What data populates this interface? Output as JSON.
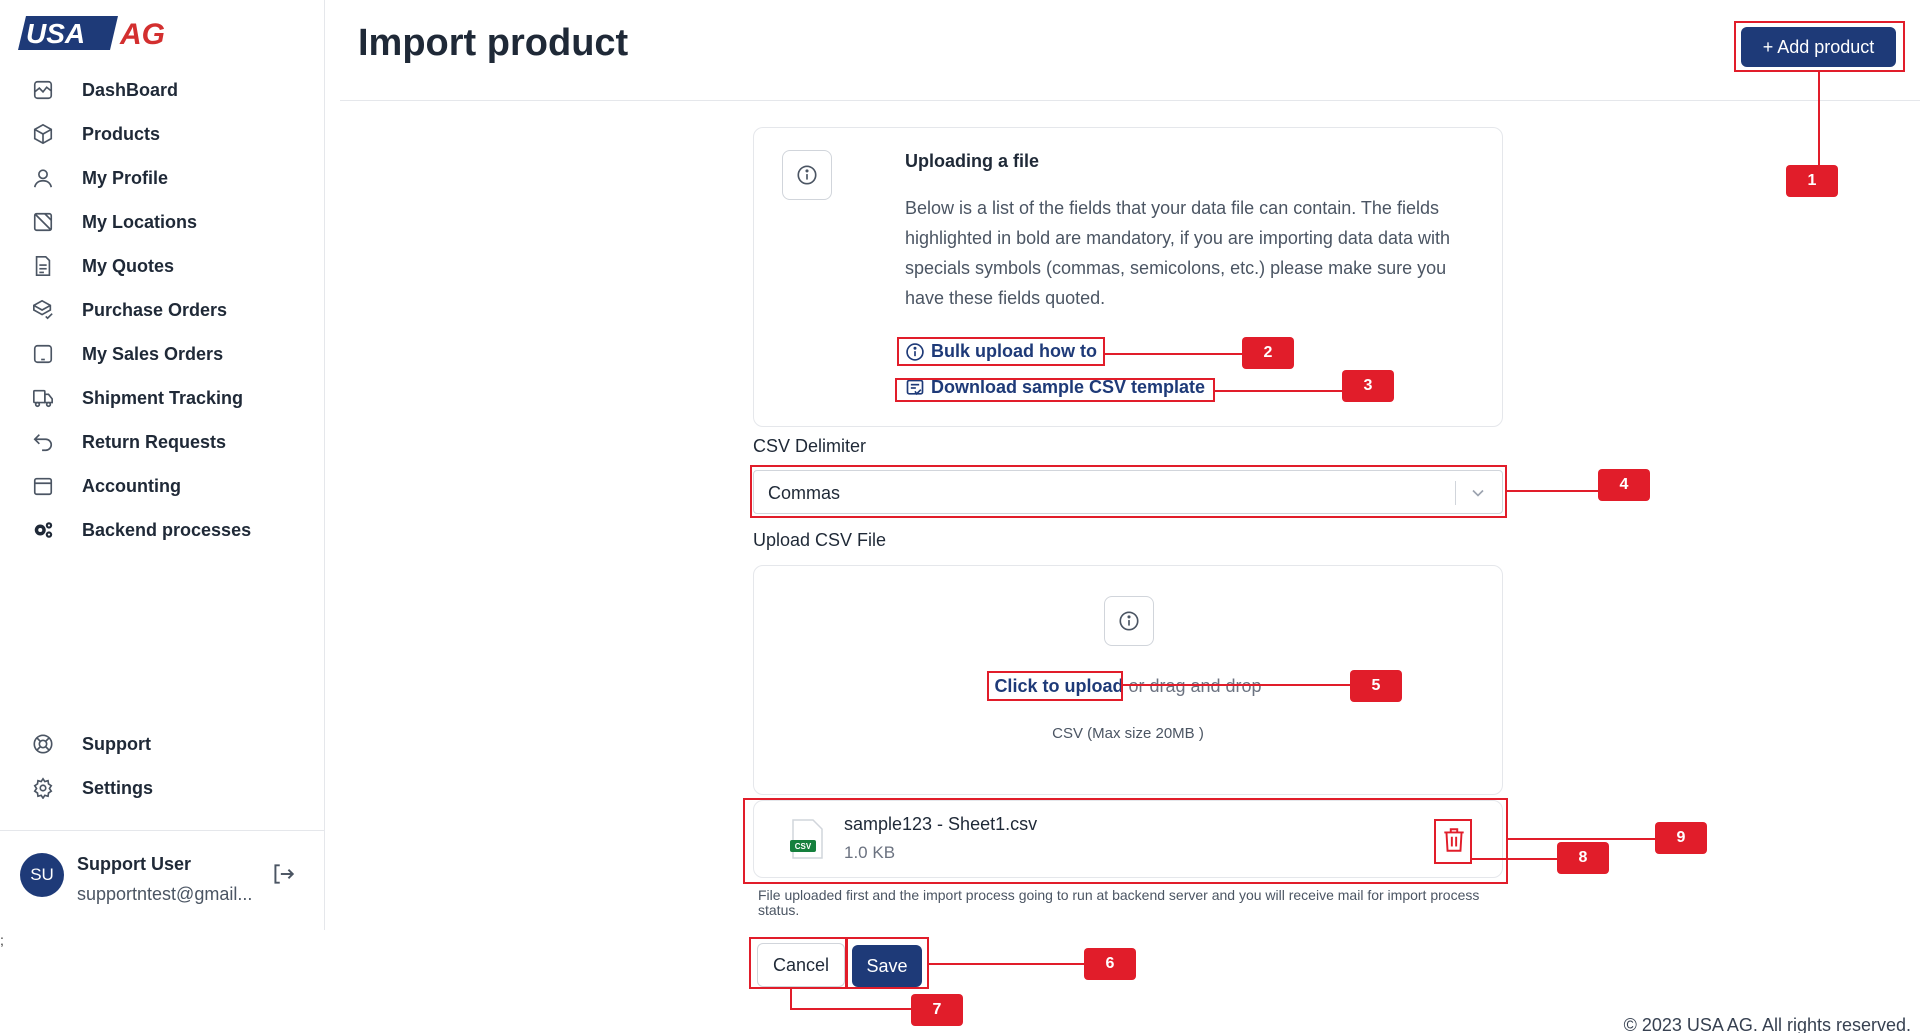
{
  "brand": {
    "logo_text_1": "USA",
    "logo_text_2": "AG"
  },
  "sidebar": {
    "items": [
      {
        "label": "DashBoard",
        "icon": "dashboard-icon"
      },
      {
        "label": "Products",
        "icon": "box-icon"
      },
      {
        "label": "My Profile",
        "icon": "user-icon"
      },
      {
        "label": "My Locations",
        "icon": "map-icon"
      },
      {
        "label": "My Quotes",
        "icon": "document-icon"
      },
      {
        "label": "Purchase Orders",
        "icon": "package-check-icon"
      },
      {
        "label": "My Sales Orders",
        "icon": "tablet-icon"
      },
      {
        "label": "Shipment Tracking",
        "icon": "truck-icon"
      },
      {
        "label": "Return Requests",
        "icon": "return-arrow-icon"
      },
      {
        "label": "Accounting",
        "icon": "wallet-icon"
      },
      {
        "label": "Backend processes",
        "icon": "gears-icon"
      }
    ],
    "bottom_items": [
      {
        "label": "Support",
        "icon": "lifebuoy-icon"
      },
      {
        "label": "Settings",
        "icon": "gear-icon"
      }
    ],
    "user": {
      "initials": "SU",
      "name": "Support User",
      "email": "supportntest@gmail..."
    }
  },
  "stray_text": ";",
  "header": {
    "title": "Import product",
    "add_button": "+ Add product"
  },
  "info_card": {
    "title": "Uploading a file",
    "body": "Below is a list of the fields that your data file can contain. The fields highlighted in bold are mandatory, if you are importing data data with specials symbols (commas, semicolons, etc.) please make sure you have these fields quoted.",
    "link_howto": "Bulk upload how to",
    "link_template": "Download sample CSV template"
  },
  "delimiter": {
    "label": "CSV Delimiter",
    "value": "Commas"
  },
  "upload": {
    "label": "Upload CSV File",
    "click_text": "Click to upload",
    "drag_text": " or drag and drop",
    "hint": "CSV (Max size 20MB )"
  },
  "file": {
    "name": "sample123 - Sheet1.csv",
    "size": "1.0 KB",
    "badge": "CSV"
  },
  "note": "File uploaded first and the import process going to run at backend server and you will receive mail for import process status.",
  "actions": {
    "cancel": "Cancel",
    "save": "Save"
  },
  "footer": "© 2023 USA AG. All rights reserved.",
  "annotations": [
    "1",
    "2",
    "3",
    "4",
    "5",
    "6",
    "7",
    "8",
    "9"
  ],
  "colors": {
    "primary": "#1e3a78",
    "annotation": "#e11d2a",
    "logo_red": "#d32f2f"
  }
}
